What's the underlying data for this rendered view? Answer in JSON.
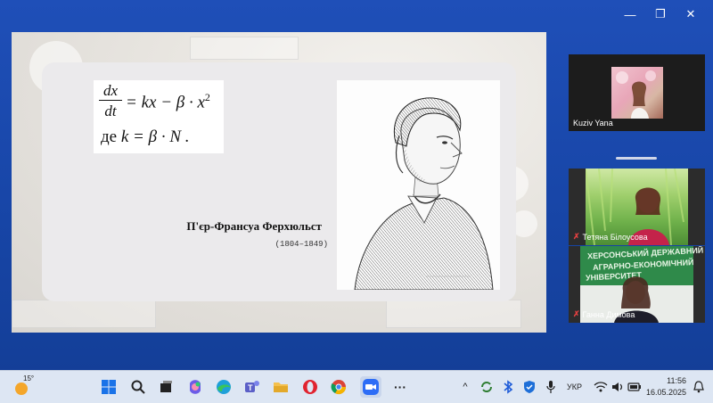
{
  "window": {
    "minimize_symbol": "—",
    "restore_symbol": "❐",
    "close_symbol": "✕"
  },
  "slide": {
    "formula": {
      "numerator": "dx",
      "denominator": "dt",
      "rhs": "= kx − β · x",
      "exponent": "2",
      "line2_prefix": "де",
      "line2_rest": "k = β · N ."
    },
    "person_name": "П'єр-Франсуа Ферхюльст",
    "person_years": "(1804–1849)"
  },
  "participants": [
    {
      "name": "Kuziv Yana",
      "muted": false
    },
    {
      "name": "Тетяна Білоусова",
      "muted": true
    },
    {
      "name": "Ганна Димова",
      "muted": true
    }
  ],
  "video_banner": {
    "line1": "ХЕРСОНСЬКИЙ ДЕРЖАВНИЙ",
    "line2": "АГРАРНО-ЕКОНОМІЧНИЙ",
    "line3": "УНІВЕРСИТЕТ"
  },
  "taskbar": {
    "weather_temp": "15°",
    "language": "УКР",
    "time": "11:56",
    "date": "16.05.2025",
    "overflow_dots": "···",
    "chevron": "^",
    "icons": [
      "windows-start-icon",
      "search-icon",
      "file-explorer-mini-icon",
      "copilot-icon",
      "edge-icon",
      "teams-icon",
      "folder-icon",
      "opera-icon",
      "chrome-icon",
      "zoom-icon",
      "more-icon"
    ]
  },
  "colors": {
    "desktop_blue": "#1a47a8",
    "taskbar": "#dde6f3",
    "opera_red": "#e1232f",
    "zoom_blue": "#2d6df6"
  }
}
